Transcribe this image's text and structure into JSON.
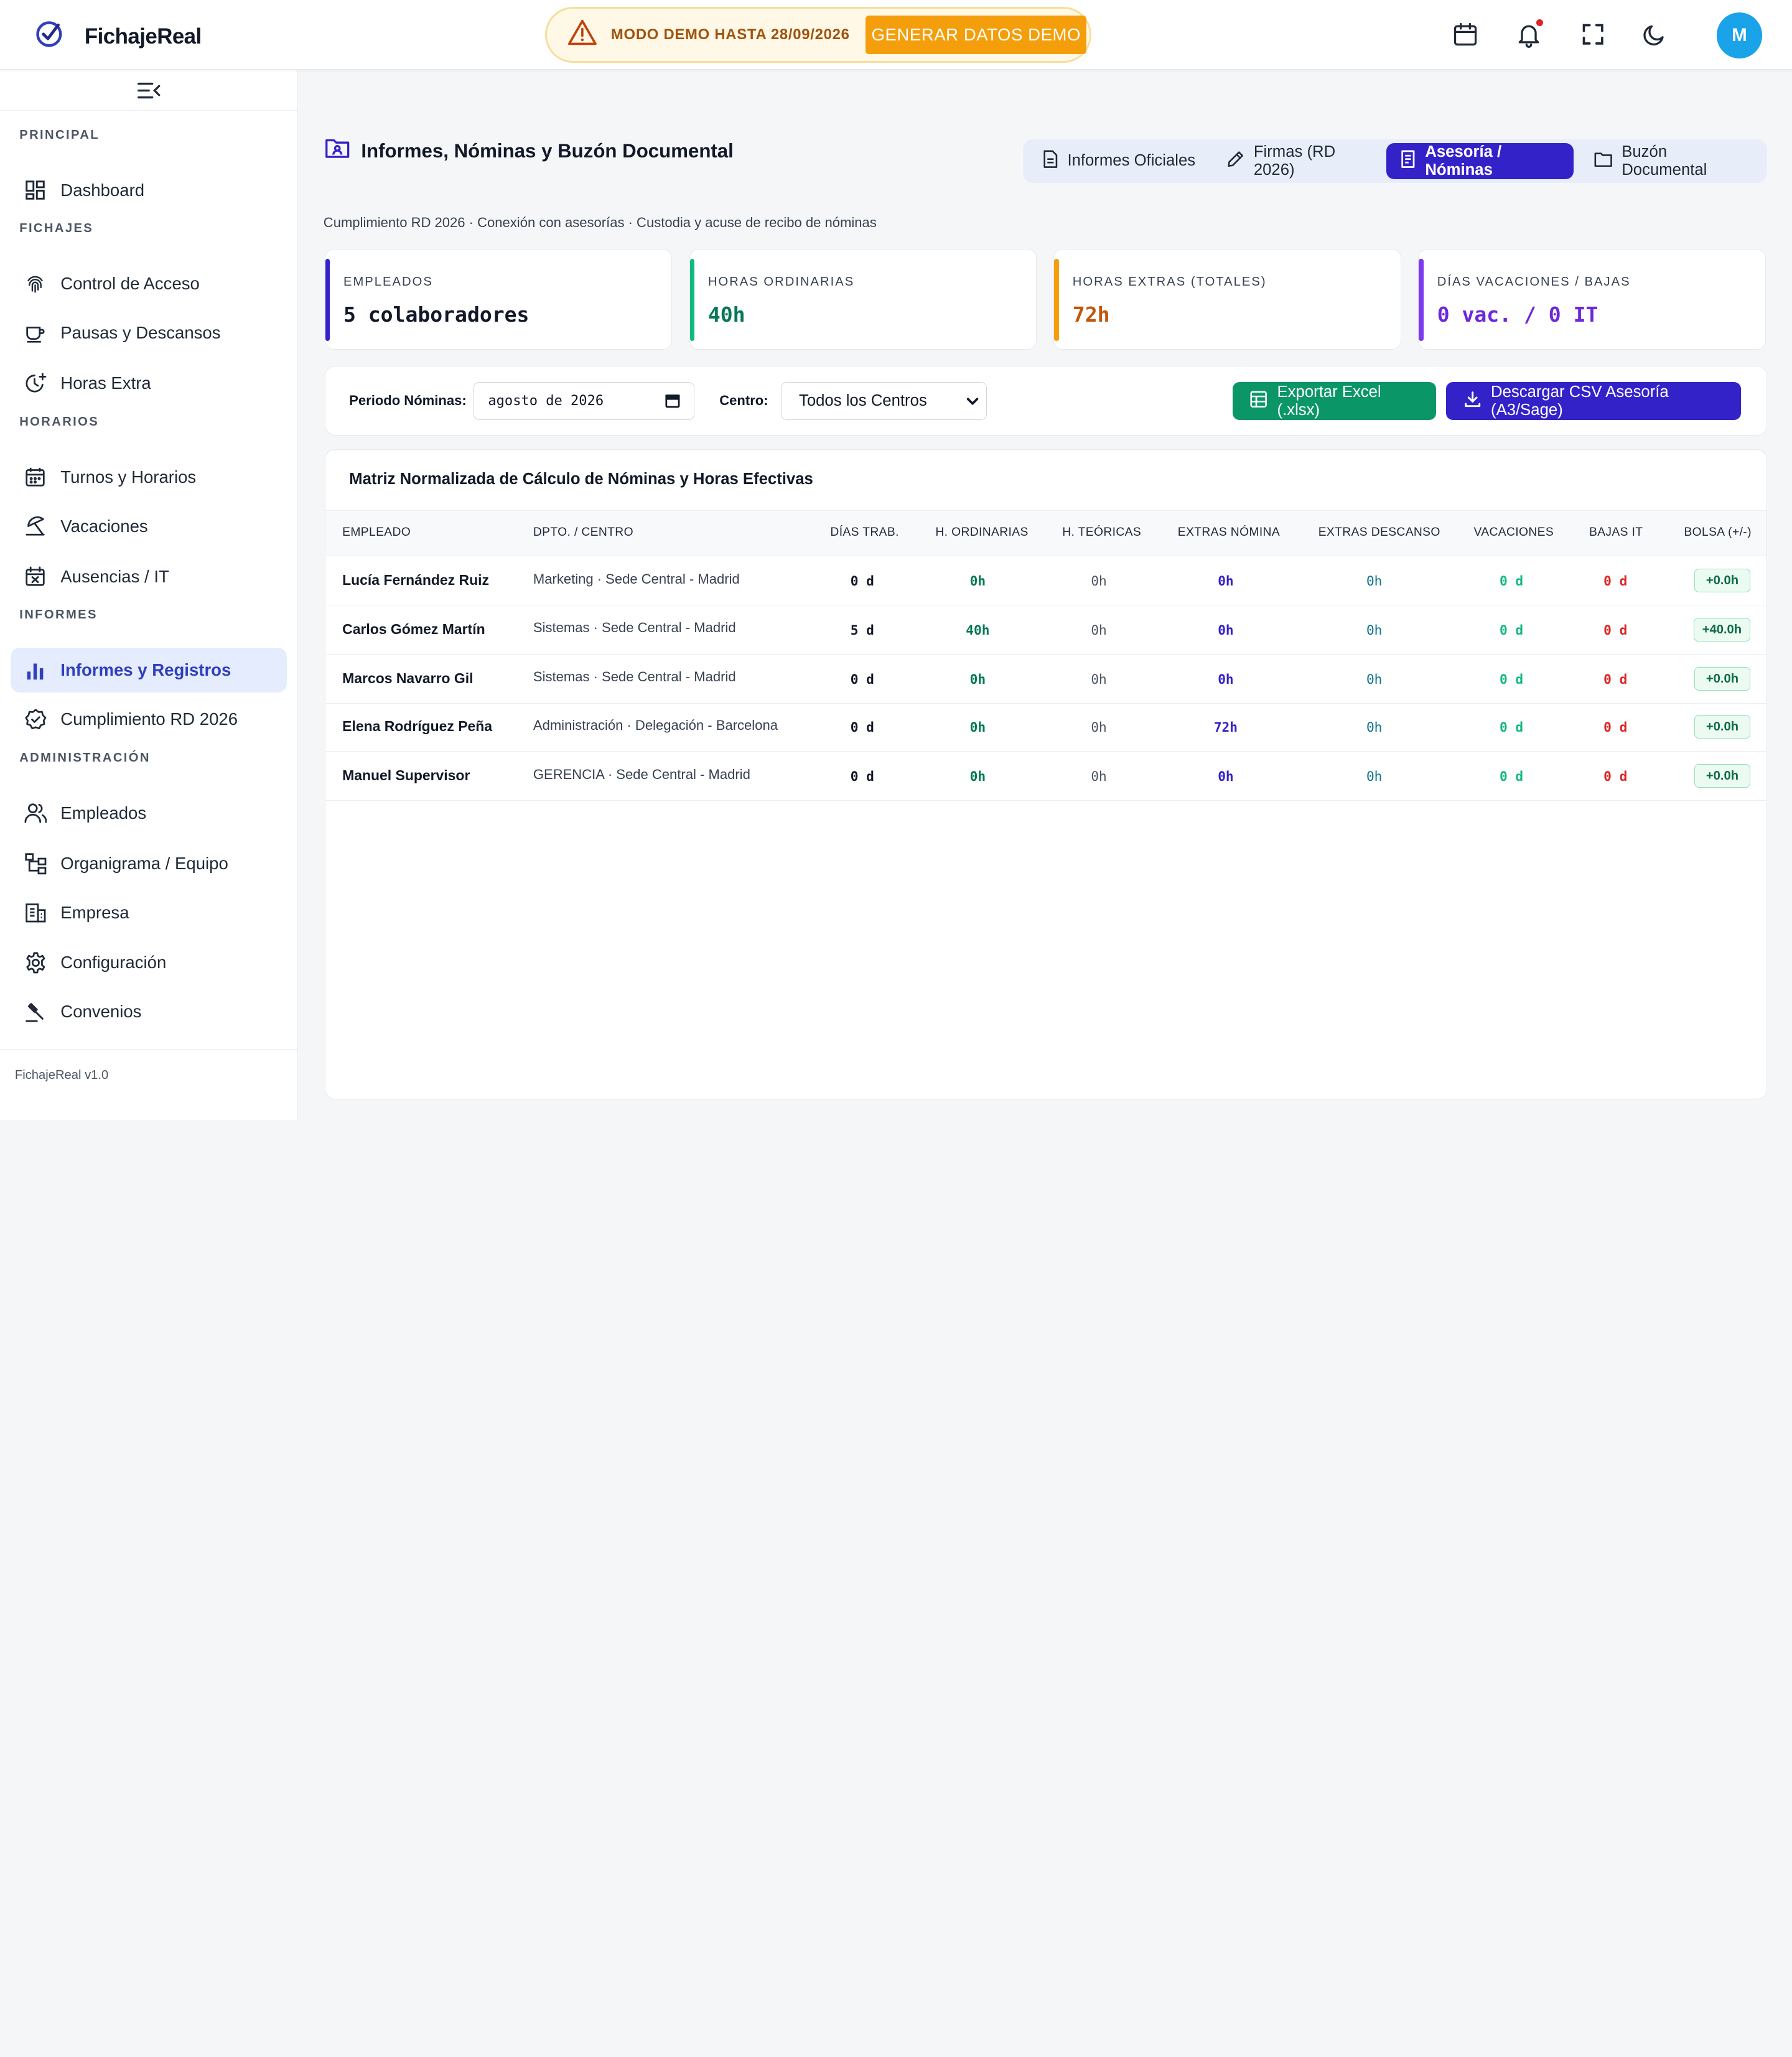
{
  "app": {
    "name": "FichajeReal",
    "version": "FichajeReal v1.0",
    "avatar_initial": "M",
    "accent": "#3422c9"
  },
  "header": {
    "demo_text": "MODO DEMO HASTA 28/09/2026",
    "demo_button": "GENERAR DATOS DEMO",
    "icons": [
      "calendar-icon",
      "bell-icon",
      "fullscreen-icon",
      "moon-icon"
    ]
  },
  "sidebar": {
    "sections": {
      "principal": "PRINCIPAL",
      "fichajes": "FICHAJES",
      "horarios": "HORARIOS",
      "informes": "INFORMES",
      "administracion": "ADMINISTRACIÓN"
    },
    "items": {
      "dashboard": "Dashboard",
      "control_acceso": "Control de Acceso",
      "pausas": "Pausas y Descansos",
      "horas_extra": "Horas Extra",
      "turnos": "Turnos y Horarios",
      "vacaciones": "Vacaciones",
      "ausencias": "Ausencias / IT",
      "informes": "Informes y Registros",
      "cumplimiento": "Cumplimiento RD 2026",
      "empleados": "Empleados",
      "organigrama": "Organigrama / Equipo",
      "empresa": "Empresa",
      "configuracion": "Configuración",
      "convenios": "Convenios"
    },
    "active": "informes"
  },
  "main": {
    "title": "Informes, Nóminas y Buzón Documental",
    "subtitle": "Cumplimiento RD 2026 · Conexión con asesorías · Custodia y acuse de recibo de nóminas",
    "tabs": [
      "Informes Oficiales",
      "Firmas (RD 2026)",
      "Asesoría / Nóminas",
      "Buzón Documental"
    ],
    "active_tab": "Asesoría / Nóminas",
    "kpis": [
      {
        "label": "EMPLEADOS",
        "value": "5 colaboradores",
        "color": "#3422c9",
        "value_color": "#111827"
      },
      {
        "label": "HORAS ORDINARIAS",
        "value": "40h",
        "color": "#10b981",
        "value_color": "#047857"
      },
      {
        "label": "HORAS EXTRAS (TOTALES)",
        "value": "72h",
        "color": "#f59e0b",
        "value_color": "#c2570c"
      },
      {
        "label": "DÍAS VACACIONES / BAJAS",
        "value": "0 vac. / 0 IT",
        "color": "#7c3aed",
        "value_color": "#6d28d9"
      }
    ],
    "filters": {
      "periodo_label": "Periodo Nóminas:",
      "periodo_value": "agosto de 2026",
      "centro_label": "Centro:",
      "centro_value": "Todos los Centros",
      "export_excel": "Exportar Excel (.xlsx)",
      "download_csv": "Descargar CSV Asesoría (A3/Sage)"
    },
    "table": {
      "title": "Matriz Normalizada de Cálculo de Nóminas y Horas Efectivas",
      "columns": [
        "EMPLEADO",
        "DPTO. / CENTRO",
        "DÍAS TRAB.",
        "H. ORDINARIAS",
        "H. TEÓRICAS",
        "EXTRAS NÓMINA",
        "EXTRAS DESCANSO",
        "VACACIONES",
        "BAJAS IT",
        "BOLSA (+/-)"
      ],
      "rows": [
        {
          "name": "Lucía Fernández Ruiz",
          "dept": "Marketing · Sede Central - Madrid",
          "dias": "0 d",
          "ord": "0h",
          "teo": "0h",
          "ext_nom": "0h",
          "ext_desc": "0h",
          "vac": "0 d",
          "bajas": "0 d",
          "bolsa": "+0.0h"
        },
        {
          "name": "Carlos Gómez Martín",
          "dept": "Sistemas · Sede Central - Madrid",
          "dias": "5 d",
          "ord": "40h",
          "teo": "0h",
          "ext_nom": "0h",
          "ext_desc": "0h",
          "vac": "0 d",
          "bajas": "0 d",
          "bolsa": "+40.0h"
        },
        {
          "name": "Marcos Navarro Gil",
          "dept": "Sistemas · Sede Central - Madrid",
          "dias": "0 d",
          "ord": "0h",
          "teo": "0h",
          "ext_nom": "0h",
          "ext_desc": "0h",
          "vac": "0 d",
          "bajas": "0 d",
          "bolsa": "+0.0h"
        },
        {
          "name": "Elena Rodríguez Peña",
          "dept": "Administración · Delegación - Barcelona",
          "dias": "0 d",
          "ord": "0h",
          "teo": "0h",
          "ext_nom": "72h",
          "ext_desc": "0h",
          "vac": "0 d",
          "bajas": "0 d",
          "bolsa": "+0.0h"
        },
        {
          "name": "Manuel Supervisor",
          "dept": "GERENCIA · Sede Central - Madrid",
          "dias": "0 d",
          "ord": "0h",
          "teo": "0h",
          "ext_nom": "0h",
          "ext_desc": "0h",
          "vac": "0 d",
          "bajas": "0 d",
          "bolsa": "+0.0h"
        }
      ]
    }
  }
}
